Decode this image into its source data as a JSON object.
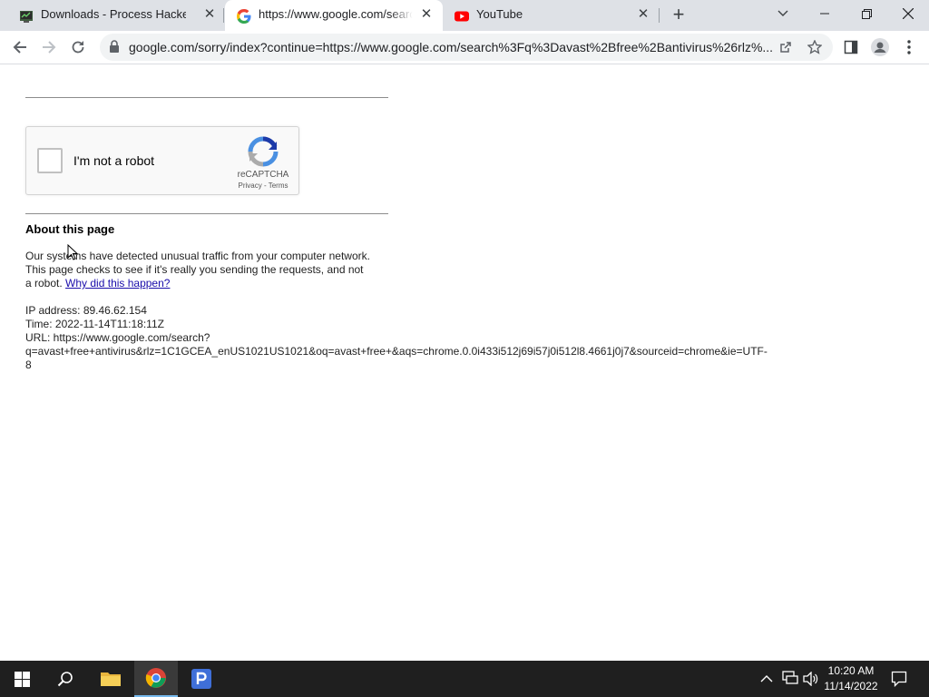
{
  "tabs": [
    {
      "title": "Downloads - Process Hacker",
      "icon": "process-hacker-icon"
    },
    {
      "title": "https://www.google.com/search?q=avast+free+antivirus",
      "icon": "google-g-icon",
      "active": true
    },
    {
      "title": "YouTube",
      "icon": "youtube-icon"
    }
  ],
  "toolbar": {
    "url": "google.com/sorry/index?continue=https://www.google.com/search%3Fq%3Davast%2Bfree%2Bantivirus%26rlz%..."
  },
  "page": {
    "captcha": {
      "label": "I'm not a robot",
      "brand": "reCAPTCHA",
      "privacy": "Privacy",
      "separator": "-",
      "terms": "Terms"
    },
    "about_heading": "About this page",
    "paragraph": "Our systems have detected unusual traffic from your computer network. This page checks to see if it's really you sending the requests, and not a robot.",
    "why_link": "Why did this happen?",
    "ip_line": "IP address: 89.46.62.154",
    "time_line": "Time: 2022-11-14T11:18:11Z",
    "url_line_1": "URL: https://www.google.com/search?",
    "url_line_2": "q=avast+free+antivirus&rlz=1C1GCEA_enUS1021US1021&oq=avast+free+&aqs=chrome.0.0i433i512j69i57j0i512l8.4661j0j7&sourceid=chrome&ie=UTF-",
    "url_line_3": "8"
  },
  "taskbar": {
    "time": "10:20 AM",
    "date": "11/14/2022"
  },
  "colors": {
    "link": "#1a0dab",
    "tabstrip": "#dee1e6",
    "taskbar": "#1f1f1f",
    "recaptcha_blue": "#4a90e2"
  }
}
